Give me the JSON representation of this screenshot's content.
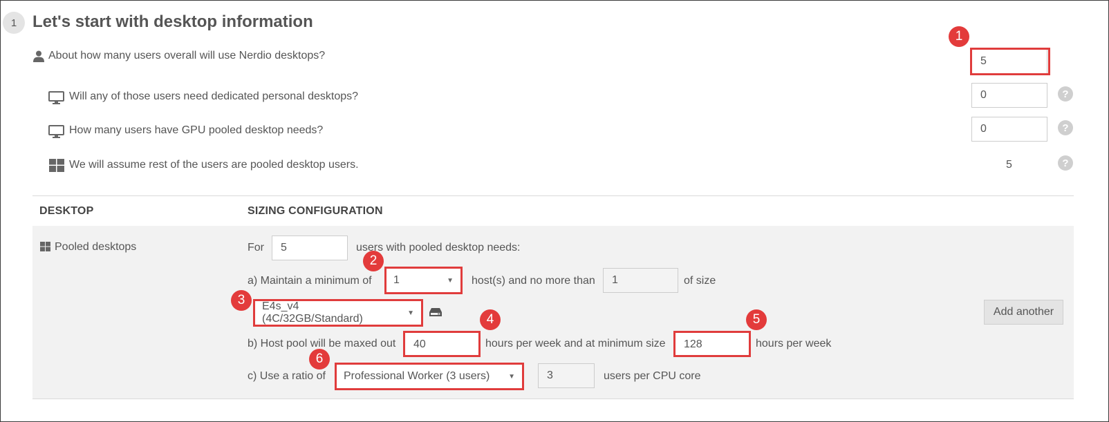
{
  "section": {
    "step_number": "1",
    "title": "Let's start with desktop information"
  },
  "questions": [
    {
      "label": "About how many users overall will use Nerdio desktops?",
      "icon": "user-icon",
      "value": "5"
    },
    {
      "label": "Will any of those users need dedicated personal desktops?",
      "icon": "monitor-icon",
      "value": "0"
    },
    {
      "label": "How many users have GPU pooled desktop needs?",
      "icon": "monitor-icon",
      "value": "0"
    },
    {
      "label": "We will assume rest of the users are pooled desktop users.",
      "icon": "windows-icon",
      "value": "5"
    }
  ],
  "help_glyph": "?",
  "table": {
    "col_desktop": "DESKTOP",
    "col_sizing": "SIZING CONFIGURATION",
    "row": {
      "desktop_label": "Pooled desktops",
      "for_label": "For",
      "for_value": "5",
      "for_suffix": "users with pooled desktop needs:",
      "maintain_label": "a) Maintain a minimum of",
      "min_hosts": "1",
      "hosts_mid": "host(s) and no more than",
      "max_hosts": "1",
      "of_size": "of size",
      "vm_size": "E4s_v4 (4C/32GB/Standard)",
      "maxed_label": "b) Host pool will be maxed out",
      "maxed_hours": "40",
      "hours_mid": "hours per week and at minimum size",
      "min_hours": "128",
      "hours_suffix": "hours per week",
      "ratio_label": "c) Use a ratio of",
      "ratio_select": "Professional Worker (3 users)",
      "ratio_value": "3",
      "ratio_suffix": "users per CPU core",
      "add_another": "Add another"
    }
  },
  "callouts": [
    "1",
    "2",
    "3",
    "4",
    "5",
    "6"
  ],
  "colors": {
    "highlight": "#e03c3c",
    "panel": "#f2f2f2",
    "text": "#555555"
  }
}
